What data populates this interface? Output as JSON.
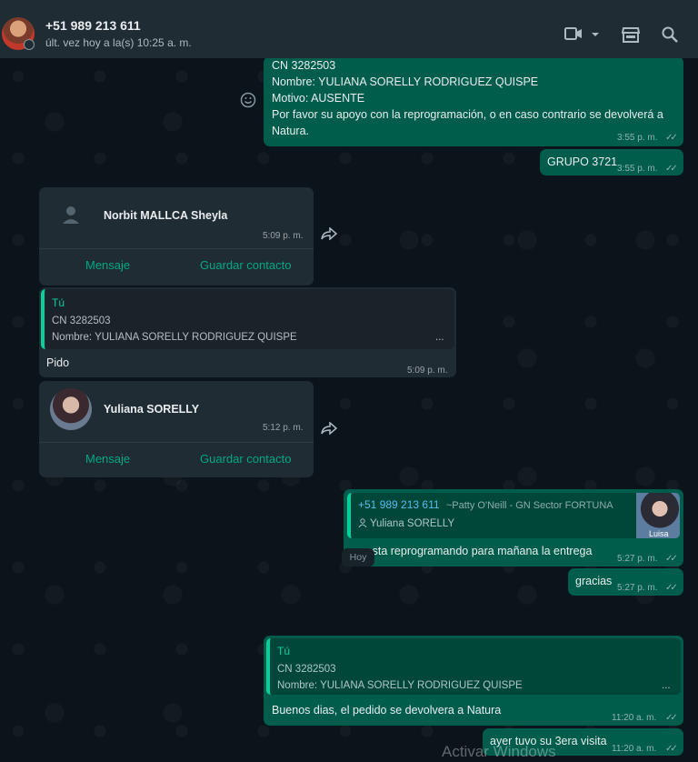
{
  "header": {
    "title": "+51 989 213 611",
    "subtitle": "últ. vez hoy a la(s) 10:25 a. m.",
    "icons": [
      "video-icon",
      "chevron-down-icon",
      "store-icon",
      "search-icon"
    ]
  },
  "messages": {
    "m1": {
      "lines": [
        "CN 3282503",
        "Nombre: YULIANA SORELLY RODRIGUEZ QUISPE",
        "Motivo: AUSENTE",
        "Por favor su apoyo con la reprogramación, o en caso contrario se devolverá a",
        "Natura."
      ],
      "time": "3:55 p. m."
    },
    "m2": {
      "text": "GRUPO 3721",
      "time": "3:55 p. m."
    },
    "m3": {
      "name": "Norbit MALLCA Sheyla",
      "time": "5:09 p. m.",
      "btn_message": "Mensaje",
      "btn_save": "Guardar contacto"
    },
    "m4": {
      "quote_author": "Tú",
      "quote_line1": "CN 3282503",
      "quote_line2": "Nombre: YULIANA SORELLY RODRIGUEZ QUISPE",
      "quote_more": "...",
      "text": "Pido",
      "time": "5:09 p. m."
    },
    "m5": {
      "name": "Yuliana SORELLY",
      "time": "5:12 p. m.",
      "btn_message": "Mensaje",
      "btn_save": "Guardar contacto"
    },
    "m6": {
      "quote_author": "+51 989 213 611",
      "quote_author_alias": "~Patty O'Neill - GN Sector FORTUNA",
      "quote_line": "Yuliana SORELLY",
      "thumb_label": "Luisa",
      "text": "se esta reprogramando para mañana la entrega",
      "time": "5:27 p. m."
    },
    "m7": {
      "text": "gracias",
      "time": "5:27 p. m."
    },
    "day": "Hoy",
    "m8": {
      "quote_author": "Tú",
      "quote_line1": "CN 3282503",
      "quote_line2": "Nombre: YULIANA SORELLY RODRIGUEZ QUISPE",
      "quote_more": "...",
      "text": "Buenos dias, el pedido se devolvera a Natura",
      "time": "11:20 a. m."
    },
    "m9": {
      "text": "ayer tuvo su 3era visita",
      "time": "11:20 a. m."
    }
  },
  "watermark": "Activar Windows",
  "colors": {
    "outgoing": "#005c4b",
    "incoming": "#202c33",
    "accent": "#00a884",
    "background": "#0b141a"
  }
}
